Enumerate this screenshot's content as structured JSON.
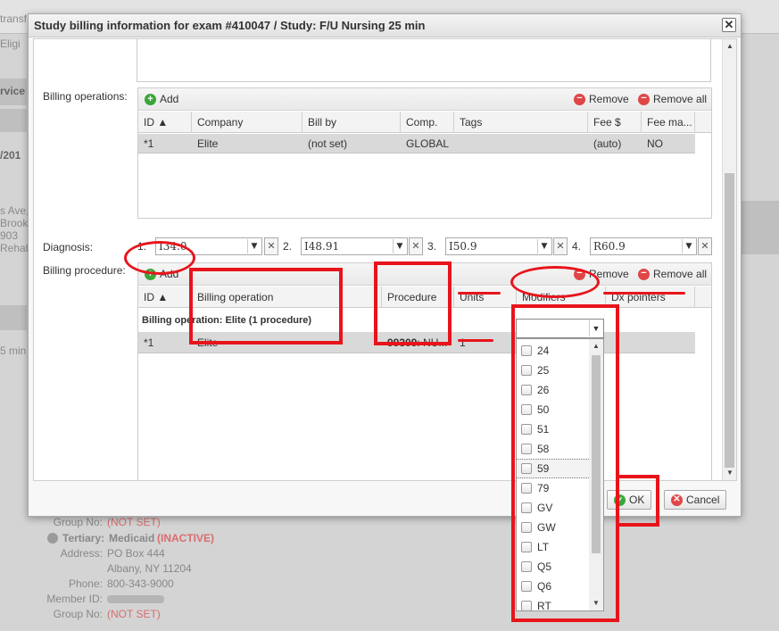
{
  "background": {
    "top_fragments": [
      "transf",
      "Eligi"
    ],
    "left_fragments": [
      "rvice",
      "/201",
      "s Ave,",
      "Brookly",
      "903",
      "Rehab",
      "5 min"
    ],
    "insurance": {
      "group_no_label": "Group No:",
      "group_no_value": "(NOT SET)",
      "tertiary_label": "Tertiary:",
      "tertiary_name": "Medicaid",
      "tertiary_status": "(INACTIVE)",
      "address_label": "Address:",
      "address_line1": "PO Box 444",
      "address_line2": "Albany, NY 11204",
      "phone_label": "Phone:",
      "phone_value": "800-343-9000",
      "member_id_label": "Member ID:",
      "group_no_label2": "Group No:",
      "group_no_value2": "(NOT SET)"
    }
  },
  "dialog": {
    "title": "Study billing information for exam #410047 / Study: F/U Nursing 25 min",
    "close_glyph": "✕"
  },
  "billing_operations": {
    "label": "Billing operations:",
    "add_label": "Add",
    "remove_label": "Remove",
    "remove_all_label": "Remove all",
    "columns": [
      "ID ▲",
      "Company",
      "Bill by",
      "Comp.",
      "Tags",
      "Fee $",
      "Fee ma..."
    ],
    "rows": [
      {
        "id": "*1",
        "company": "Elite",
        "bill_by": "(not set)",
        "comp": "GLOBAL",
        "tags": "",
        "fee": "(auto)",
        "fee_ma": "NO"
      }
    ]
  },
  "diagnosis": {
    "label": "Diagnosis:",
    "items": [
      {
        "num": "1.",
        "code": "I34.0"
      },
      {
        "num": "2.",
        "code": "I48.91"
      },
      {
        "num": "3.",
        "code": "I50.9"
      },
      {
        "num": "4.",
        "code": "R60.9"
      }
    ]
  },
  "billing_procedure": {
    "label": "Billing procedure:",
    "add_label": "Add",
    "remove_label": "Remove",
    "remove_all_label": "Remove all",
    "columns": [
      "ID ▲",
      "Billing operation",
      "Procedure",
      "Units",
      "Modifiers",
      "Dx pointers"
    ],
    "group_label": "Billing operation: Elite (1 procedure)",
    "rows": [
      {
        "id": "*1",
        "billing_operation": "Elite",
        "procedure_code": "99309",
        "procedure_rest": ": NU...",
        "units": "1"
      }
    ]
  },
  "modifiers_dropdown": {
    "selected_value": "",
    "options": [
      "24",
      "25",
      "26",
      "50",
      "51",
      "58",
      "59",
      "79",
      "GV",
      "GW",
      "LT",
      "Q5",
      "Q6",
      "RT"
    ],
    "highlighted": "59"
  },
  "buttons": {
    "ok_label": "OK",
    "cancel_label": "Cancel"
  },
  "colors": {
    "annotation_red": "#e8141b",
    "add_green": "#3aa63a",
    "remove_red": "#e04646",
    "inactive_red": "#d96d6d"
  }
}
